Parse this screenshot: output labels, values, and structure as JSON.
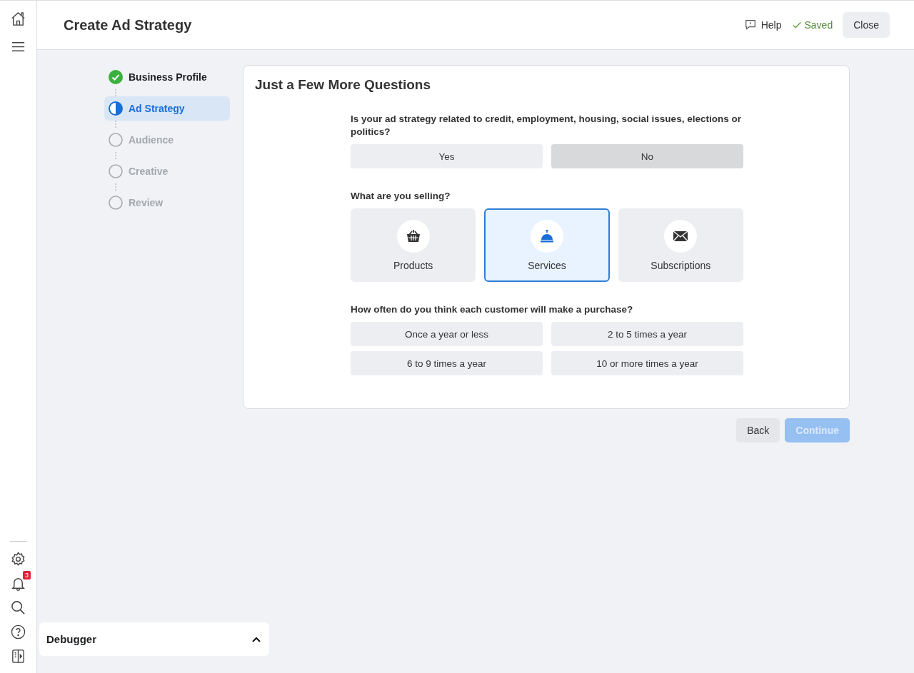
{
  "header": {
    "title": "Create Ad Strategy",
    "help": "Help",
    "saved": "Saved",
    "close": "Close"
  },
  "notifications": {
    "badge": "3"
  },
  "steps": [
    {
      "label": "Business Profile",
      "kind": "done",
      "selected": false
    },
    {
      "label": "Ad Strategy",
      "kind": "current",
      "selected": true
    },
    {
      "label": "Audience",
      "kind": "pending",
      "selected": false
    },
    {
      "label": "Creative",
      "kind": "pending",
      "selected": false
    },
    {
      "label": "Review",
      "kind": "pending",
      "selected": false
    }
  ],
  "card": {
    "title": "Just a Few More Questions",
    "questions": [
      {
        "kind": "options",
        "label": "Is your ad strategy related to credit, employment, housing, social issues, elections or politics?",
        "options": [
          {
            "label": "Yes",
            "selected": false
          },
          {
            "label": "No",
            "selected": true
          }
        ]
      },
      {
        "kind": "tiles",
        "label": "What are you selling?",
        "options": [
          {
            "label": "Products",
            "selected": false
          },
          {
            "label": "Services",
            "selected": true
          },
          {
            "label": "Subscriptions",
            "selected": false
          }
        ]
      },
      {
        "kind": "options",
        "label": "How often do you think each customer will make a purchase?",
        "options": [
          {
            "label": "Once a year or less",
            "selected": false
          },
          {
            "label": "2 to 5 times a year",
            "selected": false
          },
          {
            "label": "6 to 9 times a year",
            "selected": false
          },
          {
            "label": "10 or more times a year",
            "selected": false
          }
        ]
      }
    ]
  },
  "footer": {
    "back": "Back",
    "continue": {
      "label": "Continue",
      "disabled": true
    }
  },
  "debugger": {
    "title": "Debugger",
    "expanded": false
  }
}
